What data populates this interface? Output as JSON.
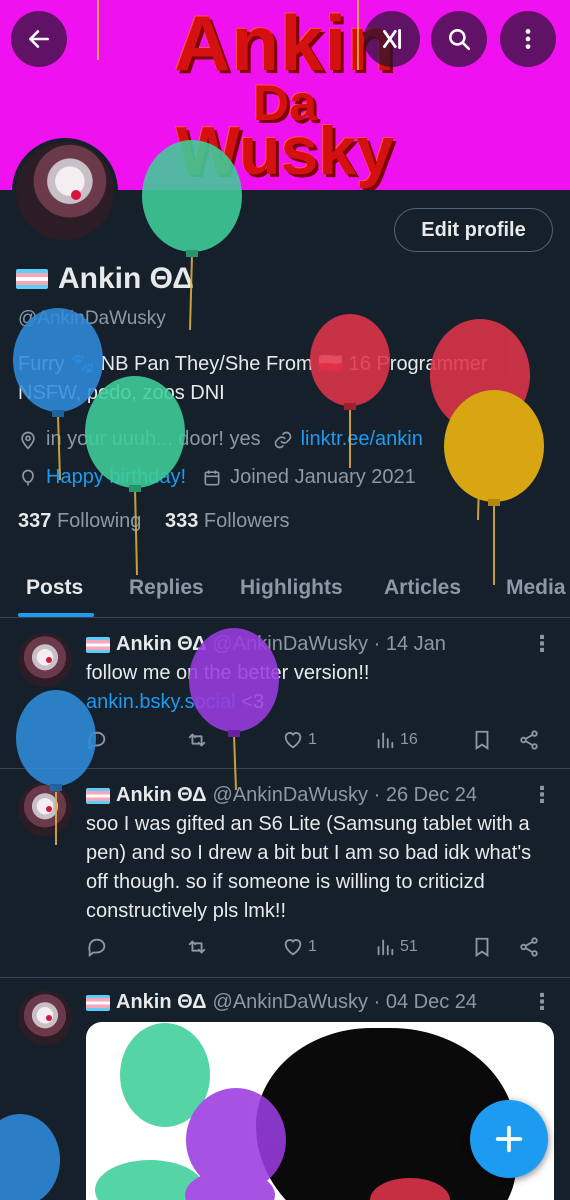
{
  "banner": {
    "line1": "Ankin",
    "line2": "Da",
    "line3": "Wusky"
  },
  "toolbar": {
    "back_icon": "arrow-left-icon",
    "grok_icon": "grok-icon",
    "search_icon": "search-icon",
    "more_icon": "more-vertical-icon"
  },
  "profile": {
    "edit_label": "Edit profile",
    "name": "Ankin ΘΔ",
    "handle": "@AnkinDaWusky",
    "bio_line1": "Furry 🐾 NB Pan They/She From 🇵🇱 16 Programmer",
    "bio_line2": "NSFW, pedo, zoos DNI",
    "location": "in your uuuh... door! yes",
    "website": "linktr.ee/ankin",
    "birthday": "Happy birthday!",
    "joined": "Joined January 2021",
    "following_count": "337",
    "following_label": "Following",
    "followers_count": "333",
    "followers_label": "Followers"
  },
  "tabs": [
    "Posts",
    "Replies",
    "Highlights",
    "Articles",
    "Media"
  ],
  "posts": [
    {
      "name": "Ankin ΘΔ",
      "handle_date": "@AnkinDaWusky · 14 Jan",
      "text1": "follow me on the better version!!",
      "link": "ankin.bsky.social",
      "text2": " <3",
      "likes": "1",
      "views": "16"
    },
    {
      "name": "Ankin ΘΔ",
      "handle_date": "@AnkinDaWusky · 26 Dec 24",
      "text": "soo I was gifted an S6 Lite (Samsung tablet with a pen) and so I drew a bit but I am so bad idk what's off though. so if someone is willing to criticizd constructively pls lmk!!",
      "likes": "1",
      "views": "51"
    },
    {
      "name": "Ankin ΘΔ",
      "handle_date": "@AnkinDaWusky · 04 Dec 24"
    }
  ],
  "fab_icon": "plus-icon",
  "colors": {
    "accent": "#1d9bf0",
    "background": "#15202b",
    "banner": "#f011f0"
  }
}
